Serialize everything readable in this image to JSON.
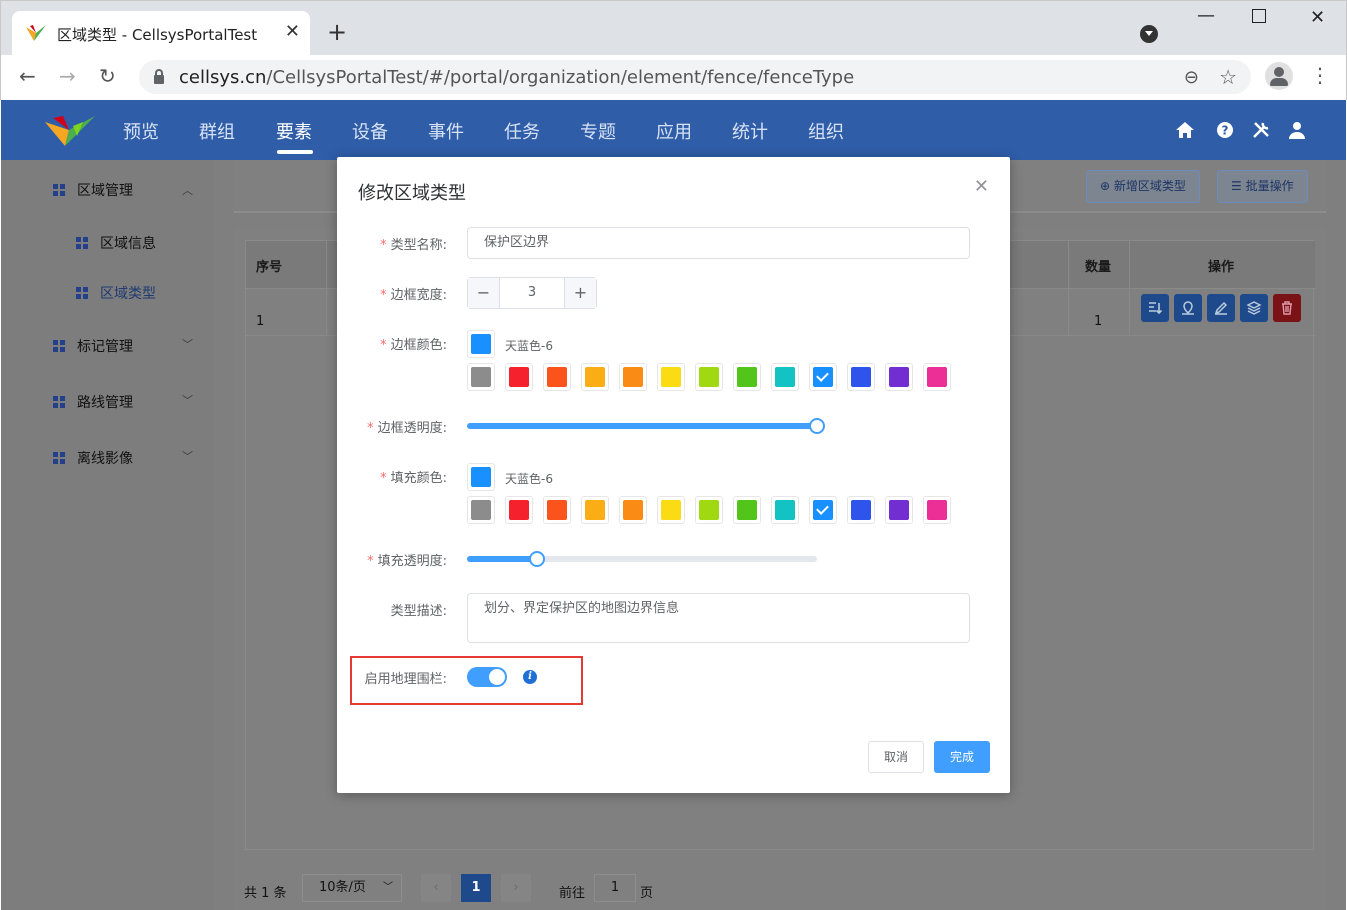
{
  "browser": {
    "tab_title": "区域类型 - CellsysPortalTest",
    "url_host": "cellsys.cn",
    "url_path": "/CellsysPortalTest/#/portal/organization/element/fence/fenceType"
  },
  "header": {
    "nav": [
      "预览",
      "群组",
      "要素",
      "设备",
      "事件",
      "任务",
      "专题",
      "应用",
      "统计",
      "组织"
    ],
    "active": "要素"
  },
  "sidebar": {
    "groups": [
      {
        "label": "区域管理",
        "children": [
          {
            "label": "区域信息"
          },
          {
            "label": "区域类型"
          }
        ]
      },
      {
        "label": "标记管理"
      },
      {
        "label": "路线管理"
      },
      {
        "label": "离线影像"
      }
    ]
  },
  "toolbar": {
    "add_label": "⊕ 新增区域类型",
    "batch_label": "☰ 批量操作"
  },
  "table": {
    "columns": {
      "index": "序号",
      "count": "数量",
      "actions": "操作"
    },
    "rows": [
      {
        "index": "1",
        "count": "1"
      }
    ]
  },
  "pagination": {
    "total": "共 1 条",
    "page_size": "10条/页",
    "prev": "‹",
    "next": "›",
    "current": "1",
    "goto_label": "前往",
    "goto_value": "1",
    "page_suffix": "页"
  },
  "modal": {
    "title": "修改区域类型",
    "name_label": "类型名称:",
    "name_value": "保护区边界",
    "border_width_label": "边框宽度:",
    "border_width_value": "3",
    "border_color_label": "边框颜色:",
    "border_color_name": "天蓝色-6",
    "border_opacity_label": "边框透明度:",
    "border_opacity_value": 1.0,
    "fill_color_label": "填充颜色:",
    "fill_color_name": "天蓝色-6",
    "fill_opacity_label": "填充透明度:",
    "fill_opacity_value": 0.2,
    "desc_label": "类型描述:",
    "desc_value": "划分、界定保护区的地图边界信息",
    "geofence_label": "启用地理围栏:",
    "geofence_enabled": true,
    "cancel_label": "取消",
    "ok_label": "完成"
  },
  "palette": [
    "#8c8c8c",
    "#f5222d",
    "#fa541c",
    "#faad14",
    "#fa8c16",
    "#fadb14",
    "#a0d911",
    "#52c41a",
    "#13c2c2",
    "#1890ff",
    "#2f54eb",
    "#722ed1",
    "#eb2f96"
  ],
  "selected_color": "#1890ff",
  "accent_color": "#409eff",
  "header_color": "#2f5da8"
}
